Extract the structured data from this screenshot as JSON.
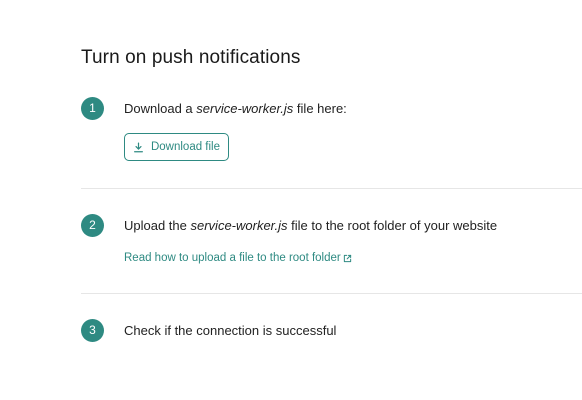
{
  "title": "Turn on push notifications",
  "steps": [
    {
      "number": "1",
      "text_before": "Download a ",
      "text_em": "service-worker.js",
      "text_after": " file here:",
      "button_label": "Download file"
    },
    {
      "number": "2",
      "text_before": "Upload the ",
      "text_em": "service-worker.js",
      "text_after": " file to the root folder of your website",
      "link_label": "Read how to upload a file to the root folder"
    },
    {
      "number": "3",
      "text": "Check if the connection is successful"
    }
  ],
  "colors": {
    "accent": "#2e8a82",
    "divider": "#e6e6e6",
    "text": "#222222"
  },
  "icons": {
    "download": "download-icon",
    "external_link": "external-link-icon"
  }
}
